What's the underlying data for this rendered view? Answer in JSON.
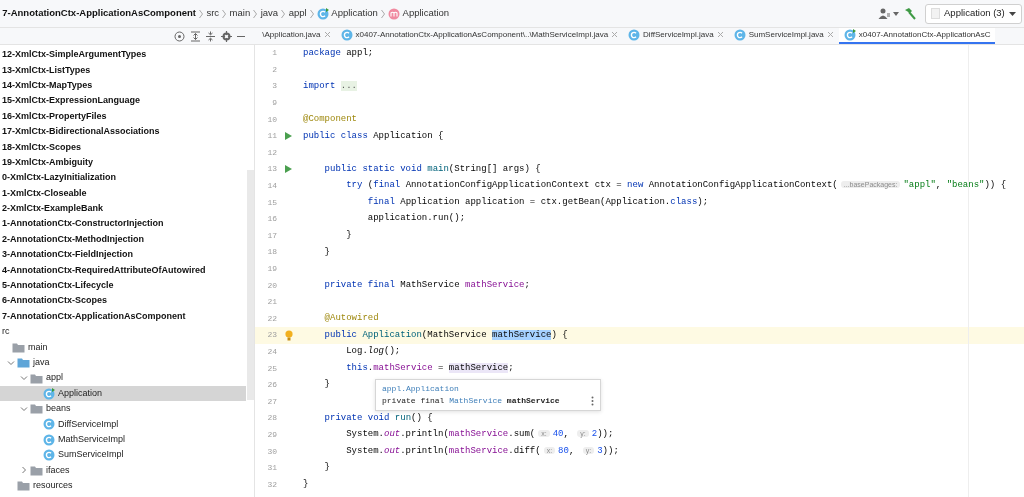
{
  "breadcrumb": [
    {
      "text": "7-AnnotationCtx-ApplicationAsComponent",
      "kind": "project"
    },
    {
      "text": "src",
      "kind": "dir"
    },
    {
      "text": "main",
      "kind": "dir"
    },
    {
      "text": "java",
      "kind": "dir"
    },
    {
      "text": "appl",
      "kind": "dir"
    },
    {
      "text": "Application",
      "kind": "class"
    },
    {
      "text": "Application",
      "kind": "method"
    }
  ],
  "run_config": "Application (3)",
  "tabs": [
    {
      "label": "\\Application.java",
      "kind": "plain",
      "closable": true,
      "selected": false
    },
    {
      "label": "x0407-AnnotationCtx-ApplicationAsComponent\\..\\MathServiceImpl.java",
      "kind": "class",
      "closable": true,
      "selected": false
    },
    {
      "label": "DiffServiceImpl.java",
      "kind": "class",
      "closable": true,
      "selected": false
    },
    {
      "label": "SumServiceImpl.java",
      "kind": "class",
      "closable": true,
      "selected": false
    },
    {
      "label": "x0407-AnnotationCtx-ApplicationAsC",
      "kind": "main-class",
      "closable": false,
      "selected": true
    }
  ],
  "tree": [
    {
      "label": "12-XmlCtx-SimpleArgumentTypes",
      "kind": "module",
      "selected": false
    },
    {
      "label": "13-XmlCtx-ListTypes",
      "kind": "module",
      "selected": false
    },
    {
      "label": "14-XmlCtx-MapTypes",
      "kind": "module",
      "selected": false
    },
    {
      "label": "15-XmlCtx-ExpressionLanguage",
      "kind": "module",
      "selected": false
    },
    {
      "label": "16-XmlCtx-PropertyFiles",
      "kind": "module",
      "selected": false
    },
    {
      "label": "17-XmlCtx-BidirectionalAssociations",
      "kind": "module",
      "selected": false
    },
    {
      "label": "18-XmlCtx-Scopes",
      "kind": "module",
      "selected": false
    },
    {
      "label": "19-XmlCtx-Ambiguity",
      "kind": "module",
      "selected": false
    },
    {
      "label": "0-XmlCtx-LazyInitialization",
      "kind": "module",
      "selected": false
    },
    {
      "label": "1-XmlCtx-Closeable",
      "kind": "module",
      "selected": false
    },
    {
      "label": "2-XmlCtx-ExampleBank",
      "kind": "module",
      "selected": false
    },
    {
      "label": "1-AnnotationCtx-ConstructorInjection",
      "kind": "module",
      "selected": false
    },
    {
      "label": "2-AnnotationCtx-MethodInjection",
      "kind": "module",
      "selected": false
    },
    {
      "label": "3-AnnotationCtx-FieldInjection",
      "kind": "module",
      "selected": false
    },
    {
      "label": "4-AnnotationCtx-RequiredAttributeOfAutowired",
      "kind": "module",
      "selected": false
    },
    {
      "label": "5-AnnotationCtx-Lifecycle",
      "kind": "module",
      "selected": false
    },
    {
      "label": "6-AnnotationCtx-Scopes",
      "kind": "module",
      "selected": false
    },
    {
      "label": "7-AnnotationCtx-ApplicationAsComponent",
      "kind": "module",
      "selected": false
    },
    {
      "label": "rc",
      "kind": "dir",
      "selected": false,
      "children": [
        {
          "label": "main",
          "kind": "folder",
          "selected": false,
          "children": [
            {
              "label": "java",
              "kind": "source",
              "expanded": true,
              "selected": false,
              "children": [
                {
                  "label": "appl",
                  "kind": "package",
                  "expanded": true,
                  "selected": false,
                  "children": [
                    {
                      "label": "Application",
                      "kind": "main-class",
                      "selected": true
                    }
                  ]
                },
                {
                  "label": "beans",
                  "kind": "package",
                  "expanded": true,
                  "selected": false,
                  "children": [
                    {
                      "label": "DiffServiceImpl",
                      "kind": "class",
                      "selected": false
                    },
                    {
                      "label": "MathServiceImpl",
                      "kind": "class",
                      "selected": false
                    },
                    {
                      "label": "SumServiceImpl",
                      "kind": "class",
                      "selected": false
                    }
                  ]
                },
                {
                  "label": "ifaces",
                  "kind": "package",
                  "expanded": false,
                  "selected": false
                }
              ]
            },
            {
              "label": "resources",
              "kind": "resources",
              "selected": false
            }
          ]
        }
      ]
    }
  ],
  "editor": {
    "lines": [
      {
        "number": "1",
        "run": false,
        "current": false,
        "tokens": [
          {
            "text": "package",
            "kind": "kw"
          },
          {
            "text": " appl;",
            "kind": "plain"
          }
        ]
      },
      {
        "number": "2",
        "run": false,
        "current": false
      },
      {
        "number": "3",
        "run": false,
        "current": false,
        "tokens": [
          {
            "text": "import ",
            "kind": "kw"
          },
          {
            "text": "...",
            "kind": "folded"
          }
        ]
      },
      {
        "number": "9",
        "run": false,
        "current": false
      },
      {
        "number": "10",
        "run": false,
        "current": false,
        "tokens": [
          {
            "text": "@Component",
            "kind": "ann"
          }
        ]
      },
      {
        "number": "11",
        "run": true,
        "current": false,
        "tokens": [
          {
            "text": "public class",
            "kind": "kw"
          },
          {
            "text": " Application {",
            "kind": "plain"
          }
        ]
      },
      {
        "number": "12",
        "run": false,
        "current": false
      },
      {
        "number": "13",
        "run": true,
        "current": false,
        "tokens": [
          {
            "text": "    public static void ",
            "kind": "kw"
          },
          {
            "text": "main",
            "kind": "fn"
          },
          {
            "text": "(String[] args) {",
            "kind": "plain"
          }
        ]
      },
      {
        "number": "14",
        "run": false,
        "current": false,
        "tokens": [
          {
            "text": "        try",
            "kind": "kw"
          },
          {
            "text": " (",
            "kind": "plain"
          },
          {
            "text": "final",
            "kind": "kw"
          },
          {
            "text": " AnnotationConfigApplicationContext ctx = ",
            "kind": "plain"
          },
          {
            "text": "new",
            "kind": "kw"
          },
          {
            "text": " AnnotationConfigApplicationContext(",
            "kind": "plain"
          },
          {
            "text": "...basePackages:",
            "kind": "hint"
          },
          {
            "text": "\"appl\"",
            "kind": "str"
          },
          {
            "text": ", ",
            "kind": "plain"
          },
          {
            "text": "\"beans\"",
            "kind": "str"
          },
          {
            "text": ")) {",
            "kind": "plain"
          }
        ]
      },
      {
        "number": "15",
        "run": false,
        "current": false,
        "tokens": [
          {
            "text": "            final",
            "kind": "kw"
          },
          {
            "text": " Application application = ctx.getBean(Application.",
            "kind": "plain"
          },
          {
            "text": "class",
            "kind": "kw"
          },
          {
            "text": ");",
            "kind": "plain"
          }
        ]
      },
      {
        "number": "16",
        "run": false,
        "current": false,
        "tokens": [
          {
            "text": "            application.run();",
            "kind": "plain"
          }
        ]
      },
      {
        "number": "17",
        "run": false,
        "current": false,
        "tokens": [
          {
            "text": "        }",
            "kind": "plain"
          }
        ]
      },
      {
        "number": "18",
        "run": false,
        "current": false,
        "tokens": [
          {
            "text": "    }",
            "kind": "plain"
          }
        ]
      },
      {
        "number": "19",
        "run": false,
        "current": false
      },
      {
        "number": "20",
        "run": false,
        "current": false,
        "tokens": [
          {
            "text": "    private final",
            "kind": "kw"
          },
          {
            "text": " MathService ",
            "kind": "plain"
          },
          {
            "text": "mathService",
            "kind": "field"
          },
          {
            "text": ";",
            "kind": "plain"
          }
        ]
      },
      {
        "number": "21",
        "run": false,
        "current": false
      },
      {
        "number": "22",
        "run": false,
        "current": false,
        "tokens": [
          {
            "text": "    @Autowired",
            "kind": "ann"
          }
        ]
      },
      {
        "number": "23",
        "run": false,
        "current": true,
        "tokens": [
          {
            "text": "    public ",
            "kind": "kw"
          },
          {
            "text": "Application",
            "kind": "fn"
          },
          {
            "text": "(MathService ",
            "kind": "plain"
          },
          {
            "text": "mathService",
            "kind": "selected"
          },
          {
            "text": ") {",
            "kind": "plain"
          }
        ]
      },
      {
        "number": "24",
        "run": false,
        "current": false,
        "tokens": [
          {
            "text": "        Log.",
            "kind": "plain"
          },
          {
            "text": "log",
            "kind": "italic"
          },
          {
            "text": "();",
            "kind": "plain"
          }
        ]
      },
      {
        "number": "25",
        "run": false,
        "current": false,
        "tokens": [
          {
            "text": "        this",
            "kind": "kw"
          },
          {
            "text": ".",
            "kind": "plain"
          },
          {
            "text": "mathService",
            "kind": "field"
          },
          {
            "text": " = ",
            "kind": "plain"
          },
          {
            "text": "mathService",
            "kind": "usage"
          },
          {
            "text": ";",
            "kind": "plain"
          }
        ]
      },
      {
        "number": "26",
        "run": false,
        "current": false,
        "tokens": [
          {
            "text": "    }",
            "kind": "plain"
          }
        ]
      },
      {
        "number": "27",
        "run": false,
        "current": false
      },
      {
        "number": "28",
        "run": false,
        "current": false,
        "tokens": [
          {
            "text": "    private void ",
            "kind": "kw"
          },
          {
            "text": "run",
            "kind": "fn"
          },
          {
            "text": "() {",
            "kind": "plain"
          }
        ]
      },
      {
        "number": "29",
        "run": false,
        "current": false,
        "tokens": [
          {
            "text": "        System.",
            "kind": "plain"
          },
          {
            "text": "out",
            "kind": "static"
          },
          {
            "text": ".println(",
            "kind": "plain"
          },
          {
            "text": "mathService",
            "kind": "field"
          },
          {
            "text": ".sum(",
            "kind": "plain"
          },
          {
            "text": "x:",
            "kind": "hint"
          },
          {
            "text": "40",
            "kind": "num"
          },
          {
            "text": ", ",
            "kind": "plain"
          },
          {
            "text": "y:",
            "kind": "hint"
          },
          {
            "text": "2",
            "kind": "num"
          },
          {
            "text": "));",
            "kind": "plain"
          }
        ]
      },
      {
        "number": "30",
        "run": false,
        "current": false,
        "tokens": [
          {
            "text": "        System.",
            "kind": "plain"
          },
          {
            "text": "out",
            "kind": "static"
          },
          {
            "text": ".println(",
            "kind": "plain"
          },
          {
            "text": "mathService",
            "kind": "field"
          },
          {
            "text": ".diff(",
            "kind": "plain"
          },
          {
            "text": "x:",
            "kind": "hint"
          },
          {
            "text": "80",
            "kind": "num"
          },
          {
            "text": ", ",
            "kind": "plain"
          },
          {
            "text": "y:",
            "kind": "hint"
          },
          {
            "text": "3",
            "kind": "num"
          },
          {
            "text": "));",
            "kind": "plain"
          }
        ]
      },
      {
        "number": "31",
        "run": false,
        "current": false,
        "tokens": [
          {
            "text": "    }",
            "kind": "plain"
          }
        ]
      },
      {
        "number": "32",
        "run": false,
        "current": false,
        "tokens": [
          {
            "text": "}",
            "kind": "plain"
          }
        ]
      }
    ],
    "popup": {
      "location": "appl.Application",
      "tokens": [
        {
          "text": "private final ",
          "kind": "plain"
        },
        {
          "text": "MathService ",
          "kind": "link"
        },
        {
          "text": "mathService",
          "kind": "bold"
        }
      ]
    }
  }
}
